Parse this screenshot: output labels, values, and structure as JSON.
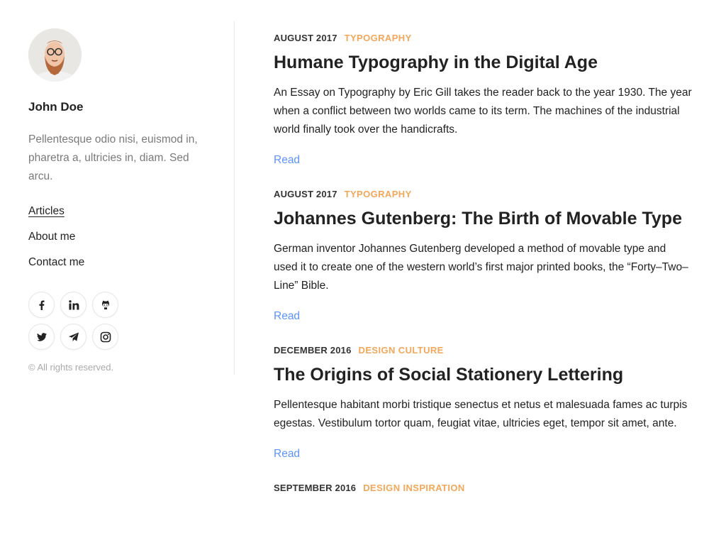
{
  "author": {
    "name": "John Doe",
    "bio": "Pellentesque odio nisi, euismod in, pharetra a, ultricies in, diam. Sed arcu.",
    "avatar_icon": "avatar-portrait"
  },
  "menu": [
    {
      "label": "Articles",
      "active": true
    },
    {
      "label": "About me",
      "active": false
    },
    {
      "label": "Contact me",
      "active": false
    }
  ],
  "social": [
    {
      "name": "facebook-icon"
    },
    {
      "name": "linkedin-icon"
    },
    {
      "name": "github-icon"
    },
    {
      "name": "twitter-icon"
    },
    {
      "name": "telegram-icon"
    },
    {
      "name": "instagram-icon"
    }
  ],
  "copyright": "© All rights reserved.",
  "colors": {
    "accent_category": "#f3a75a",
    "link": "#5d93ff",
    "text": "#222222",
    "muted": "#7a7a7a"
  },
  "posts": [
    {
      "date": "AUGUST 2017",
      "category": "TYPOGRAPHY",
      "title": "Humane Typography in the Digital Age",
      "excerpt": "An Essay on Typography by Eric Gill takes the reader back to the year 1930. The year when a conflict between two worlds came to its term. The machines of the industrial world finally took over the handicrafts.",
      "read_label": "Read"
    },
    {
      "date": "AUGUST 2017",
      "category": "TYPOGRAPHY",
      "title": "Johannes Gutenberg: The Birth of Movable Type",
      "excerpt": "German inventor Johannes Gutenberg developed a method of movable type and used it to create one of the western world’s first major printed books, the “Forty–Two–Line” Bible.",
      "read_label": "Read"
    },
    {
      "date": "DECEMBER 2016",
      "category": "DESIGN CULTURE",
      "title": "The Origins of Social Stationery Lettering",
      "excerpt": "Pellentesque habitant morbi tristique senectus et netus et malesuada fames ac turpis egestas. Vestibulum tortor quam, feugiat vitae, ultricies eget, tempor sit amet, ante.",
      "read_label": "Read"
    },
    {
      "date": "SEPTEMBER 2016",
      "category": "DESIGN INSPIRATION"
    }
  ]
}
